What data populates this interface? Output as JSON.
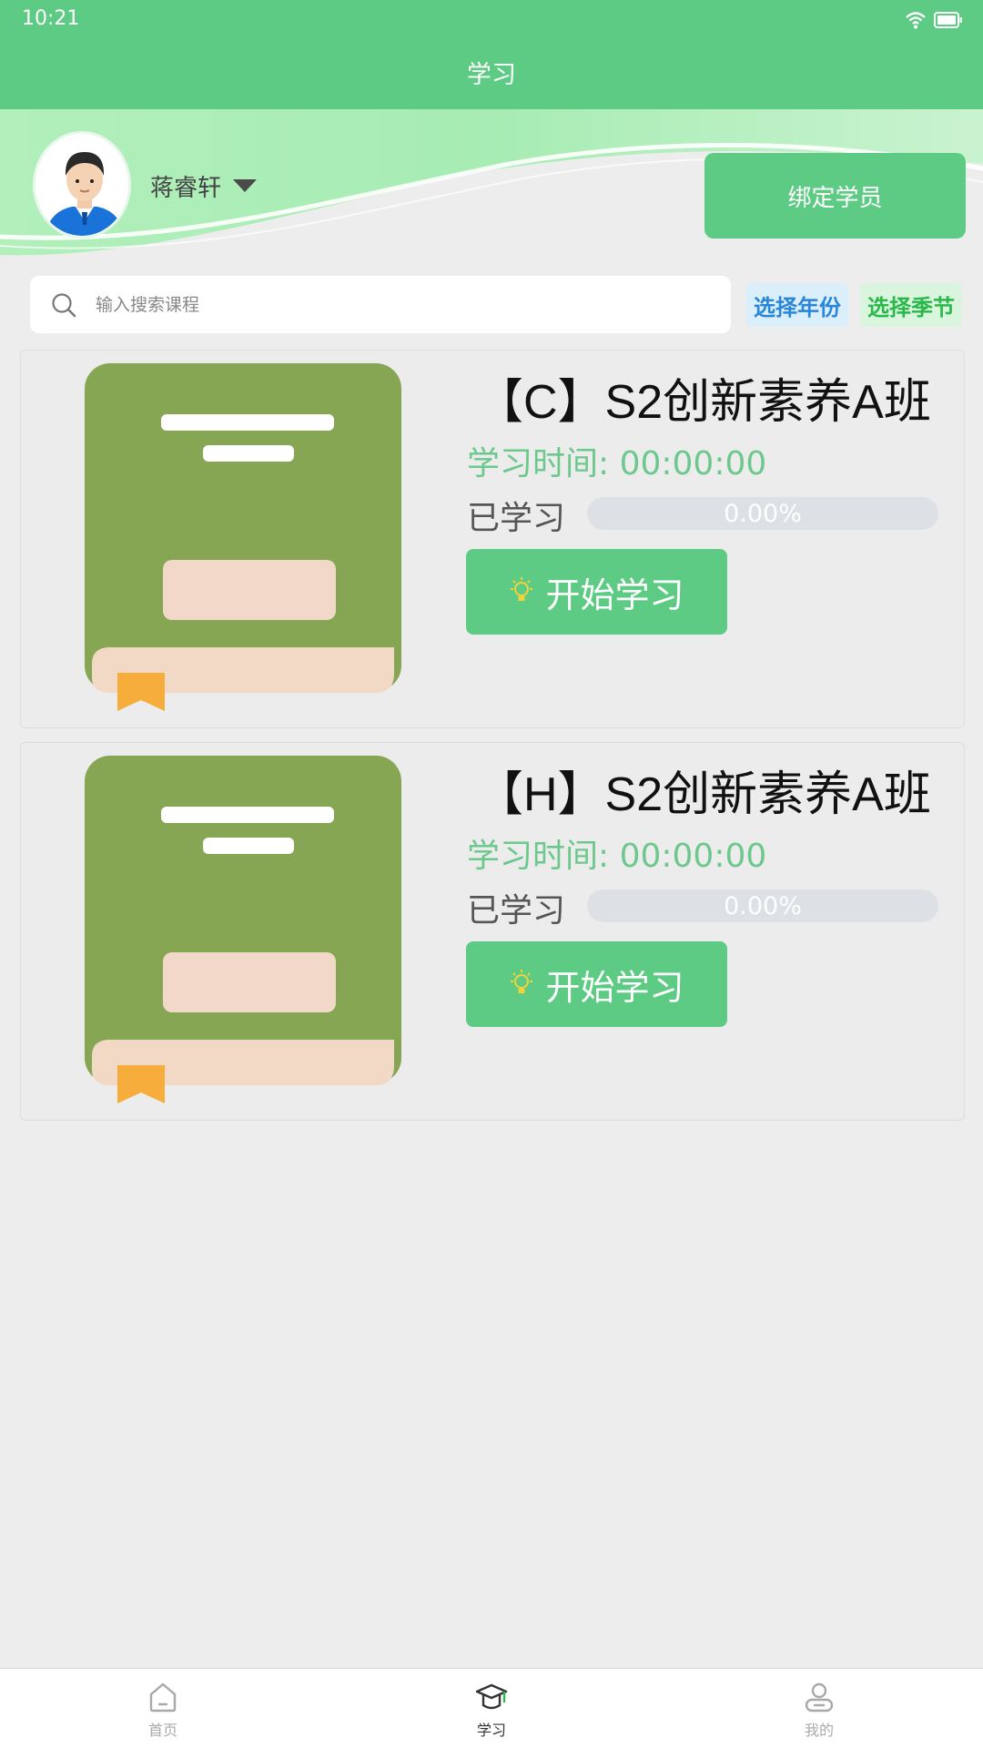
{
  "status_bar": {
    "time": "10:21"
  },
  "header": {
    "title": "学习"
  },
  "user": {
    "name": "蒋睿轩"
  },
  "bind_button": {
    "label": "绑定学员"
  },
  "search": {
    "placeholder": "输入搜索课程"
  },
  "filters": {
    "year_label": "选择年份",
    "season_label": "选择季节"
  },
  "courses": [
    {
      "title": "【C】S2创新素养A班",
      "study_time": "学习时间: 00:00:00",
      "learned_label": "已学习",
      "progress_text": "0.00%",
      "progress": 0.0,
      "start_label": "开始学习"
    },
    {
      "title": "【H】S2创新素养A班",
      "study_time": "学习时间: 00:00:00",
      "learned_label": "已学习",
      "progress_text": "0.00%",
      "progress": 0.0,
      "start_label": "开始学习"
    }
  ],
  "tabbar": {
    "items": [
      {
        "label": "首页",
        "icon": "home-icon",
        "active": false
      },
      {
        "label": "学习",
        "icon": "graduation-cap-icon",
        "active": true
      },
      {
        "label": "我的",
        "icon": "user-icon",
        "active": false
      }
    ]
  },
  "colors": {
    "accent": "#5ecb84",
    "progress_track": "#dde0e4",
    "year_chip": "#2a86d8",
    "season_chip": "#2bb84a"
  }
}
